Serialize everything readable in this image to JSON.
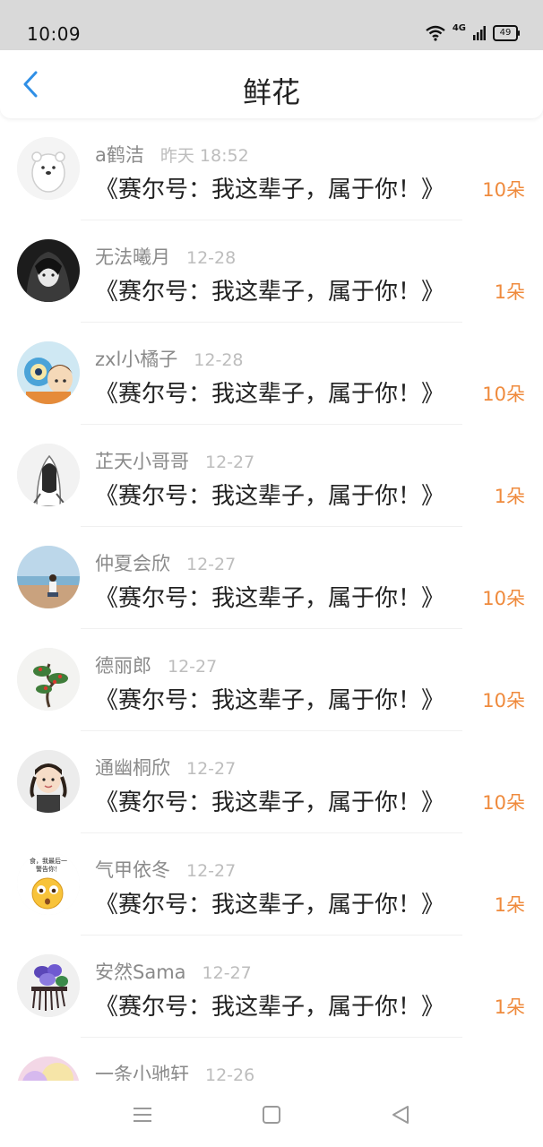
{
  "status_bar": {
    "time": "10:09",
    "network": "4G",
    "battery": "49"
  },
  "header": {
    "title": "鲜花"
  },
  "items": [
    {
      "username": "a鹤洁",
      "time": "昨天 18:52",
      "title": "《赛尔号：我这辈子，属于你！》",
      "count": "10朵",
      "avatar_icon": "polar-bear-avatar"
    },
    {
      "username": "无法曦月",
      "time": "12-28",
      "title": "《赛尔号：我这辈子，属于你！》",
      "count": "1朵",
      "avatar_icon": "dark-anime-avatar"
    },
    {
      "username": "zxl小橘子",
      "time": "12-28",
      "title": "《赛尔号：我这辈子，属于你！》",
      "count": "10朵",
      "avatar_icon": "cartoon-duo-avatar"
    },
    {
      "username": "芷天小哥哥",
      "time": "12-27",
      "title": "《赛尔号：我这辈子，属于你！》",
      "count": "1朵",
      "avatar_icon": "sketch-girl-avatar"
    },
    {
      "username": "仲夏会欣",
      "time": "12-27",
      "title": "《赛尔号：我这辈子，属于你！》",
      "count": "10朵",
      "avatar_icon": "beach-avatar"
    },
    {
      "username": "德丽郎",
      "time": "12-27",
      "title": "《赛尔号：我这辈子，属于你！》",
      "count": "10朵",
      "avatar_icon": "bonsai-avatar"
    },
    {
      "username": "通幽桐欣",
      "time": "12-27",
      "title": "《赛尔号：我这辈子，属于你！》",
      "count": "10朵",
      "avatar_icon": "little-girl-avatar"
    },
    {
      "username": "气甲依冬",
      "time": "12-27",
      "title": "《赛尔号：我这辈子，属于你！》",
      "count": "1朵",
      "avatar_icon": "emoji-meme-avatar",
      "avatar_text": [
        "食，我最后一",
        "警告你！"
      ]
    },
    {
      "username": "安然Sama",
      "time": "12-27",
      "title": "《赛尔号：我这辈子，属于你！》",
      "count": "1朵",
      "avatar_icon": "flower-comb-avatar"
    },
    {
      "username": "一条小驰轩",
      "time": "12-26",
      "title": "",
      "count": "",
      "avatar_icon": "pastel-avatar"
    }
  ],
  "colors": {
    "accent_blue": "#2f8fe6",
    "count_orange": "#ef8a3c"
  }
}
